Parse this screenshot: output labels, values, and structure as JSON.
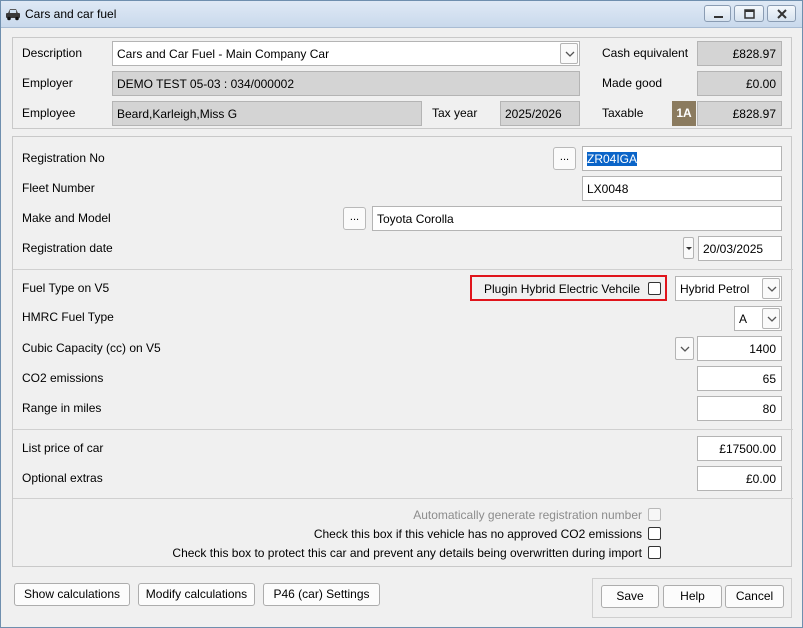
{
  "window": {
    "title": "Cars and car fuel"
  },
  "header": {
    "description_label": "Description",
    "description_value": "Cars and Car Fuel - Main Company Car",
    "employer_label": "Employer",
    "employer_value": "DEMO TEST 05-03 : 034/000002",
    "employee_label": "Employee",
    "employee_value": "Beard,Karleigh,Miss G",
    "tax_year_label": "Tax year",
    "tax_year_value": "2025/2026",
    "cash_equivalent_label": "Cash equivalent",
    "cash_equivalent_value": "£828.97",
    "made_good_label": "Made good",
    "made_good_value": "£0.00",
    "taxable_label": "Taxable",
    "taxable_badge": "1A",
    "taxable_value": "£828.97"
  },
  "vehicle": {
    "registration_label": "Registration No",
    "registration_value": "ZR04IGA",
    "fleet_label": "Fleet Number",
    "fleet_value": "LX0048",
    "make_model_label": "Make and Model",
    "make_model_value": "Toyota Corolla",
    "reg_date_label": "Registration date",
    "reg_date_value": "20/03/2025",
    "browse_label": "..."
  },
  "fuel": {
    "fuel_type_label": "Fuel Type on V5",
    "phev_label": "Plugin Hybrid Electric Vehcile",
    "phev_checked": false,
    "fuel_type_value": "Hybrid Petrol",
    "hmrc_label": "HMRC Fuel Type",
    "hmrc_value": "A",
    "cc_label": "Cubic Capacity (cc) on V5",
    "cc_value": "1400",
    "co2_label": "CO2 emissions",
    "co2_value": "65",
    "range_label": "Range in miles",
    "range_value": "80"
  },
  "price": {
    "list_label": "List price of car",
    "list_value": "£17500.00",
    "extras_label": "Optional extras",
    "extras_value": "£0.00"
  },
  "options": {
    "auto_reg_label": "Automatically generate registration number",
    "no_co2_label": "Check this box if this vehicle has no approved CO2 emissions",
    "protect_label": "Check this box to protect this car and prevent any details being overwritten during import"
  },
  "footer": {
    "show_calc": "Show calculations",
    "modify_calc": "Modify calculations",
    "p46": "P46 (car) Settings",
    "save": "Save",
    "help": "Help",
    "cancel": "Cancel"
  },
  "colors": {
    "highlight": "#e0141b",
    "badge": "#8b7b5f",
    "selection": "#0a64c8"
  },
  "icons": [
    "car-icon",
    "minimize-icon",
    "maximize-icon",
    "close-icon",
    "chevron-down-icon"
  ]
}
